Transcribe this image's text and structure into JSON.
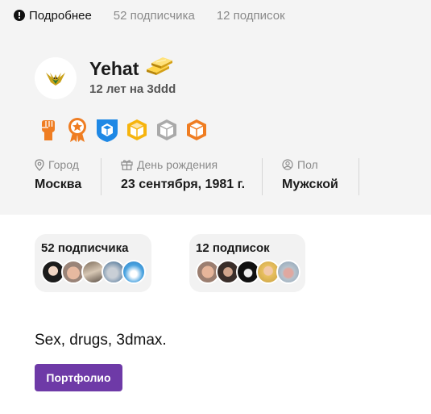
{
  "tabs": [
    {
      "label": "Подробнее",
      "active": true,
      "icon": "exclamation-icon"
    },
    {
      "label": "52 подписчика",
      "active": false
    },
    {
      "label": "12 подписок",
      "active": false
    }
  ],
  "profile": {
    "username": "Yehat",
    "member_since": "12 лет на 3ddd",
    "avatar_icon": "bird-avatar",
    "status_icon": "gold-bars-icon",
    "badges": [
      {
        "name": "fist-badge",
        "color": "#ef7d22"
      },
      {
        "name": "star-medal-badge",
        "color": "#ef7d22"
      },
      {
        "name": "blue-cube-shield-badge",
        "color": "#1e88e5"
      },
      {
        "name": "gold-cube-badge",
        "color": "#f6b40e"
      },
      {
        "name": "silver-cube-badge",
        "color": "#a9a9a9"
      },
      {
        "name": "bronze-cube-badge",
        "color": "#ef7d22"
      }
    ],
    "info": {
      "city_label": "Город",
      "city_value": "Москва",
      "birthday_label": "День рождения",
      "birthday_value": "23 сентября, 1981 г.",
      "gender_label": "Пол",
      "gender_value": "Мужской"
    }
  },
  "followers": {
    "title": "52 подписчика"
  },
  "following": {
    "title": "12 подписок"
  },
  "about": "Sex, drugs, 3dmax.",
  "portfolio_button": "Портфолио",
  "colors": {
    "accent": "#6e3aa7",
    "card_bg": "#f4f4f4",
    "badge_orange": "#ef7d22"
  }
}
